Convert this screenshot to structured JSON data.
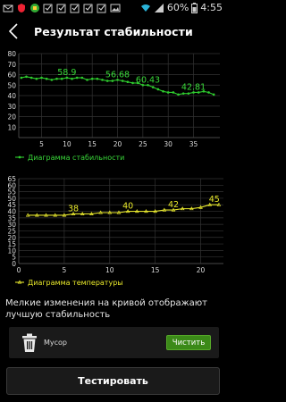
{
  "status_bar": {
    "battery": "60%",
    "time": "4:55",
    "icons": [
      "email-icon",
      "shield-icon",
      "app-icon",
      "checkbox-icon",
      "checkbox-icon",
      "checkbox-icon",
      "checkbox-icon",
      "checkbox-icon",
      "image-icon",
      "wifi-icon",
      "signal-icon",
      "battery-icon"
    ]
  },
  "header": {
    "title": "Результат стабильности"
  },
  "description": "Мелкие изменения на кривой отображают лучшую стабильность",
  "junk": {
    "label": "Мусор",
    "clean_button": "Чистить"
  },
  "test_button": "Тестировать",
  "colors": {
    "stability": "#2ecc2e",
    "temperature": "#e6e62e",
    "label_stability": "#39d939",
    "label_temperature": "#e8e82a",
    "clean_green": "#3b8a18"
  },
  "chart_data": [
    {
      "type": "line",
      "legend": "Диаграмма стабильности",
      "x": [
        1,
        2,
        3,
        4,
        5,
        6,
        7,
        8,
        9,
        10,
        11,
        12,
        13,
        14,
        15,
        16,
        17,
        18,
        19,
        20,
        21,
        22,
        23,
        24,
        25,
        26,
        27,
        28,
        29,
        30,
        31,
        32,
        33,
        34,
        35,
        36,
        37,
        38,
        39
      ],
      "y": [
        57,
        58,
        57,
        56,
        57,
        56,
        55,
        56,
        56,
        57,
        56,
        57,
        57,
        55,
        56,
        56,
        55,
        54,
        54,
        55,
        54,
        53,
        52,
        52,
        50,
        50,
        48,
        46,
        44,
        43,
        43,
        41,
        42,
        42,
        43,
        43,
        44,
        43,
        41
      ],
      "annotations": [
        {
          "x": 10,
          "label": "58.9"
        },
        {
          "x": 20,
          "label": "56.68"
        },
        {
          "x": 26,
          "label": "60.43"
        },
        {
          "x": 35,
          "label": "42.81"
        }
      ],
      "xticks": [
        5,
        10,
        15,
        20,
        25,
        30,
        35
      ],
      "yticks": [
        10,
        20,
        30,
        40,
        50,
        60,
        70,
        80
      ],
      "ylim": [
        0,
        80
      ],
      "grid": true,
      "legend_position": "bottom-left"
    },
    {
      "type": "line",
      "legend": "Диаграмма температуры",
      "x": [
        1,
        2,
        3,
        4,
        5,
        6,
        7,
        8,
        9,
        10,
        11,
        12,
        13,
        14,
        15,
        16,
        17,
        18,
        19,
        20,
        21,
        22
      ],
      "y": [
        37,
        37,
        37,
        37,
        37,
        38,
        38,
        38,
        39,
        39,
        39,
        40,
        40,
        40,
        40,
        41,
        41,
        42,
        42,
        43,
        45,
        45
      ],
      "annotations": [
        {
          "x": 6,
          "label": "38"
        },
        {
          "x": 12,
          "label": "40"
        },
        {
          "x": 17,
          "label": "42"
        },
        {
          "x": 21.5,
          "label": "45"
        }
      ],
      "xticks": [
        0,
        5,
        10,
        15,
        20
      ],
      "yticks": [
        0,
        5,
        10,
        15,
        20,
        25,
        30,
        35,
        40,
        45,
        50,
        55,
        60,
        65
      ],
      "ylim": [
        0,
        65
      ],
      "grid": true,
      "legend_position": "bottom-left"
    }
  ]
}
